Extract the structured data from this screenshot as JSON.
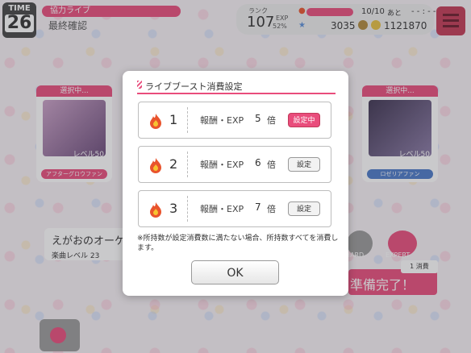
{
  "timer": {
    "label": "TIME",
    "value": "26"
  },
  "header": {
    "live_type": "協力ライブ",
    "subtitle": "最終確認",
    "rank_label": "ランク",
    "rank_value": "107",
    "exp_label": "EXP",
    "exp_percent": "52%",
    "stamina": "10/10",
    "stamina_after_label": "あと",
    "timer_text": "- - : - -",
    "coins": "3035",
    "gold": "1121870"
  },
  "cards": {
    "left": {
      "selected_label": "選択中...",
      "level": "レベル50",
      "band": "アフターグロウファン"
    },
    "right": {
      "selected_label": "選択中...",
      "level": "レベル50",
      "band": "ロゼリアファン"
    }
  },
  "song": {
    "title": "えがおのオーケ",
    "level": "楽曲レベル 23"
  },
  "difficulty": {
    "hard": "HARD",
    "expert": "EXPERT"
  },
  "ready": {
    "label": "準備完了！",
    "consume": "1 消費"
  },
  "dialog": {
    "title": "ライブブースト消費設定",
    "options": [
      {
        "num": "1",
        "reward": "報酬・EXP",
        "mult": "5",
        "unit": "倍",
        "button": "設定中",
        "active": true
      },
      {
        "num": "2",
        "reward": "報酬・EXP",
        "mult": "6",
        "unit": "倍",
        "button": "設定",
        "active": false
      },
      {
        "num": "3",
        "reward": "報酬・EXP",
        "mult": "7",
        "unit": "倍",
        "button": "設定",
        "active": false
      }
    ],
    "note": "※所持数が設定消費数に満たない場合、所持数すべてを消費します。",
    "ok_label": "OK"
  },
  "colors": {
    "accent": "#e94d7c",
    "fire": "#e9542d"
  },
  "icons": [
    "clock-icon",
    "fire-icon",
    "star-icon",
    "coin-icon",
    "menu-icon"
  ]
}
